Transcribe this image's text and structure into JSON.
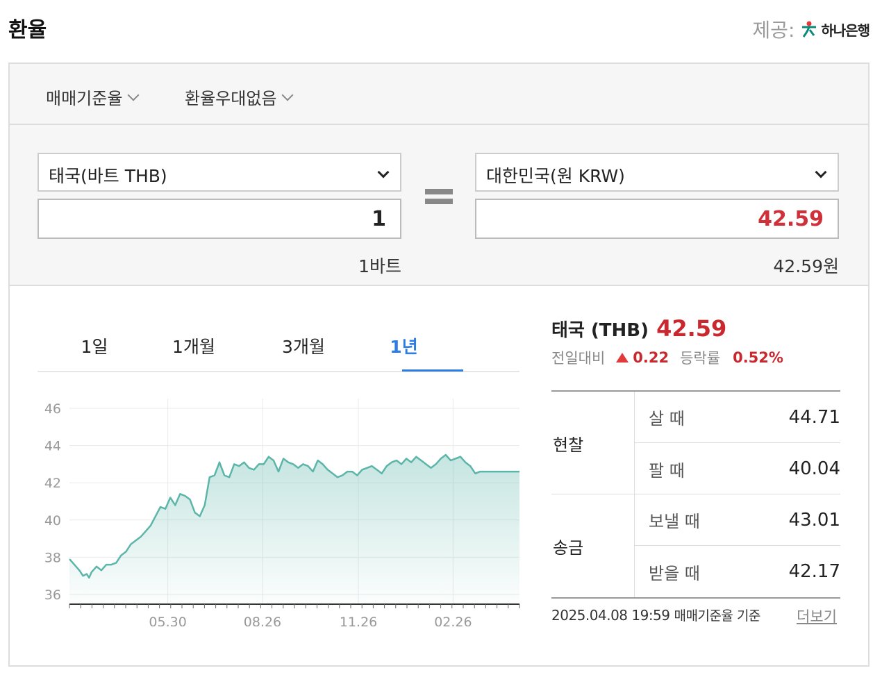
{
  "header": {
    "title": "환율",
    "provider_label": "제공:",
    "provider_name": "하나은행"
  },
  "options": {
    "rate_type": "매매기준율",
    "preference": "환율우대없음"
  },
  "converter": {
    "from_currency": "태국(바트 THB)",
    "from_amount": "1",
    "from_unit_text": "1바트",
    "to_currency": "대한민국(원 KRW)",
    "to_amount": "42.59",
    "to_unit_text": "42.59원"
  },
  "tabs": [
    "1일",
    "1개월",
    "3개월",
    "1년"
  ],
  "active_tab": "1년",
  "summary": {
    "country": "태국 (THB)",
    "rate": "42.59",
    "change_label": "전일대비",
    "change_value": "0.22",
    "rate_change_label": "등락률",
    "rate_change_value": "0.52%"
  },
  "table": {
    "cash": {
      "label": "현찰",
      "buy_label": "살 때",
      "buy_value": "44.71",
      "sell_label": "팔 때",
      "sell_value": "40.04"
    },
    "remit": {
      "label": "송금",
      "send_label": "보낼 때",
      "send_value": "43.01",
      "receive_label": "받을 때",
      "receive_value": "42.17"
    }
  },
  "footer": {
    "timestamp": "2025.04.08 19:59",
    "basis": "매매기준율 기준",
    "more": "더보기"
  },
  "colors": {
    "accent": "#2f7de1",
    "rate_red": "#c8282e",
    "line": "#5bb5a8"
  },
  "chart_data": {
    "type": "area",
    "x_ticks": [
      "05.30",
      "08.26",
      "11.26",
      "02.26"
    ],
    "y_ticks": [
      36,
      38,
      40,
      42,
      44,
      46
    ],
    "ylim": [
      36,
      46
    ],
    "grid": true,
    "series": [
      {
        "x": [
          0,
          4,
          8,
          11,
          14,
          16,
          18,
          22,
          26,
          30,
          34,
          38,
          42,
          46,
          50,
          54,
          58,
          62,
          66,
          70,
          74,
          78,
          82,
          86,
          90,
          94,
          98,
          102,
          106,
          110,
          114,
          118,
          122,
          126,
          130,
          134,
          138,
          142,
          146,
          150,
          154,
          158,
          162,
          166,
          170,
          174,
          178,
          182,
          186,
          190,
          194,
          198,
          202,
          206,
          210,
          214,
          218,
          222,
          226,
          230,
          234,
          238,
          242,
          246,
          250,
          254,
          258,
          262,
          266,
          270,
          274,
          278,
          282,
          286,
          290,
          294,
          298,
          302,
          306,
          310,
          314,
          318,
          322,
          326,
          330,
          334,
          338,
          342,
          346,
          350,
          354,
          358,
          362,
          366
        ],
        "y": [
          37.9,
          37.6,
          37.3,
          37.0,
          37.1,
          36.9,
          37.2,
          37.5,
          37.3,
          37.6,
          37.6,
          37.7,
          38.1,
          38.3,
          38.7,
          38.9,
          39.1,
          39.4,
          39.7,
          40.2,
          40.7,
          40.6,
          41.2,
          40.8,
          41.4,
          41.3,
          41.1,
          40.4,
          40.2,
          40.8,
          42.3,
          42.4,
          43.1,
          42.4,
          42.3,
          43.0,
          42.9,
          43.1,
          42.8,
          42.7,
          43.0,
          43.0,
          43.4,
          43.2,
          42.6,
          43.3,
          43.1,
          43.0,
          42.8,
          43.0,
          42.9,
          42.6,
          43.2,
          43.0,
          42.7,
          42.5,
          42.3,
          42.4,
          42.6,
          42.6,
          42.4,
          42.7,
          42.8,
          42.9,
          42.7,
          42.5,
          42.9,
          43.1,
          43.2,
          43.0,
          43.3,
          43.1,
          43.4,
          43.2,
          43.0,
          42.8,
          43.0,
          43.3,
          43.5,
          43.2,
          43.3,
          43.4,
          43.1,
          42.9,
          42.5,
          42.6,
          42.6,
          42.6,
          42.6,
          42.6,
          42.6,
          42.6,
          42.6,
          42.6
        ]
      }
    ]
  }
}
